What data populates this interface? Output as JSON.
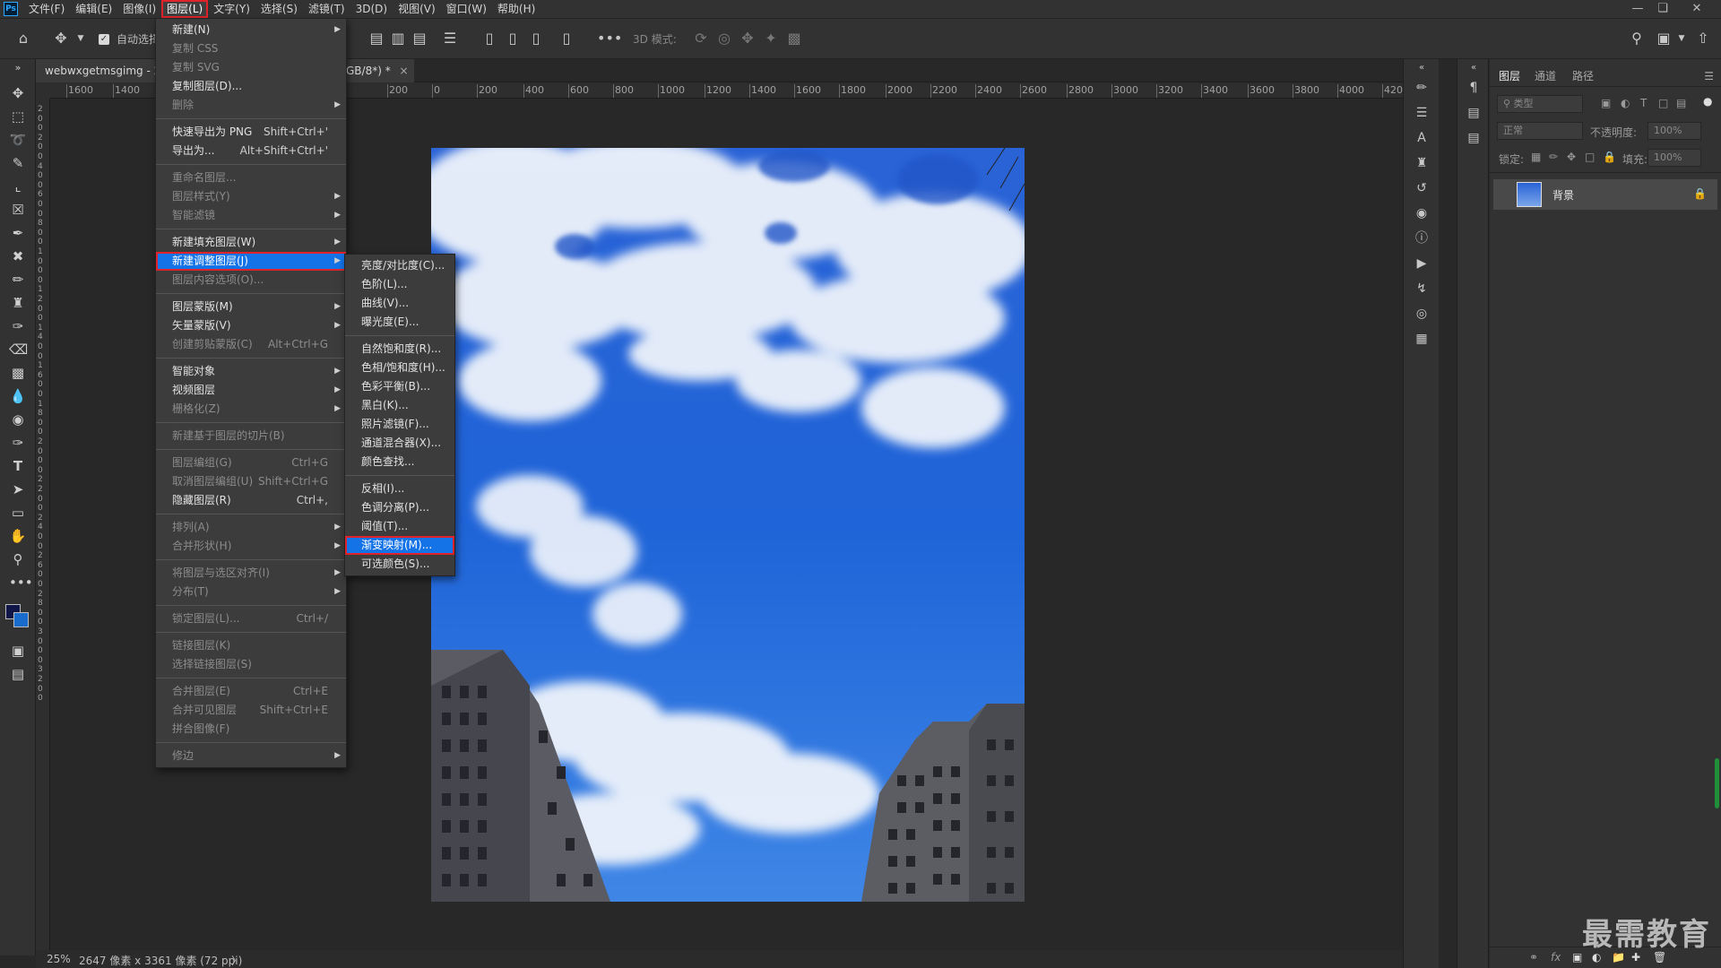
{
  "menubar": {
    "logo": "Ps",
    "items": [
      "文件(F)",
      "编辑(E)",
      "图像(I)",
      "图层(L)",
      "文字(Y)",
      "选择(S)",
      "滤镜(T)",
      "3D(D)",
      "视图(V)",
      "窗口(W)",
      "帮助(H)"
    ],
    "active_index": 3
  },
  "options": {
    "auto_select_label": "自动选择",
    "mode_3d_label": "3D 模式:"
  },
  "doc_tab": {
    "title": "webwxgetmsgimg - 2",
    "title_suffix": "GB/8*) *",
    "close": "×"
  },
  "ruler": {
    "h_ticks": [
      "1600",
      "1400",
      "200",
      "0",
      "200",
      "400",
      "600",
      "800",
      "1000",
      "1200",
      "1400",
      "1600",
      "1800",
      "2000",
      "2200",
      "2400",
      "2600",
      "2800",
      "3000",
      "3200",
      "3400",
      "3600",
      "3800",
      "4000",
      "4200"
    ],
    "v_ticks": [
      "2",
      "0",
      "0",
      "2",
      "0",
      "0",
      "4",
      "0",
      "0",
      "6",
      "0",
      "0",
      "8",
      "0",
      "0",
      "1",
      "0",
      "0",
      "0",
      "1",
      "2",
      "0",
      "0",
      "1",
      "4",
      "0",
      "0",
      "1",
      "6",
      "0",
      "0",
      "1",
      "8",
      "0",
      "0",
      "2",
      "0",
      "0",
      "0",
      "2",
      "2",
      "0",
      "0",
      "2",
      "4",
      "0",
      "0",
      "2",
      "6",
      "0",
      "0",
      "2",
      "8",
      "0",
      "0",
      "3",
      "0",
      "0",
      "0",
      "3",
      "2",
      "0",
      "0"
    ]
  },
  "status": {
    "zoom": "25%",
    "doc_info": "2647 像素 x 3361 像素 (72 ppi)",
    "arrow": "〉"
  },
  "layer_menu": {
    "items": [
      {
        "label": "新建(N)",
        "shortcut": "",
        "submenu": true,
        "disabled": false
      },
      {
        "label": "复制 CSS",
        "shortcut": "",
        "submenu": false,
        "disabled": true
      },
      {
        "label": "复制 SVG",
        "shortcut": "",
        "submenu": false,
        "disabled": true
      },
      {
        "label": "复制图层(D)...",
        "shortcut": "",
        "submenu": false,
        "disabled": false
      },
      {
        "label": "删除",
        "shortcut": "",
        "submenu": true,
        "disabled": true
      },
      {
        "sep": true
      },
      {
        "label": "快速导出为 PNG",
        "shortcut": "Shift+Ctrl+'",
        "submenu": false,
        "disabled": false
      },
      {
        "label": "导出为...",
        "shortcut": "Alt+Shift+Ctrl+'",
        "submenu": false,
        "disabled": false
      },
      {
        "sep": true
      },
      {
        "label": "重命名图层...",
        "shortcut": "",
        "submenu": false,
        "disabled": true
      },
      {
        "label": "图层样式(Y)",
        "shortcut": "",
        "submenu": true,
        "disabled": true
      },
      {
        "label": "智能滤镜",
        "shortcut": "",
        "submenu": true,
        "disabled": true
      },
      {
        "sep": true
      },
      {
        "label": "新建填充图层(W)",
        "shortcut": "",
        "submenu": true,
        "disabled": false
      },
      {
        "label": "新建调整图层(J)",
        "shortcut": "",
        "submenu": true,
        "disabled": false,
        "highlight": true
      },
      {
        "label": "图层内容选项(O)...",
        "shortcut": "",
        "submenu": false,
        "disabled": true
      },
      {
        "sep": true
      },
      {
        "label": "图层蒙版(M)",
        "shortcut": "",
        "submenu": true,
        "disabled": false
      },
      {
        "label": "矢量蒙版(V)",
        "shortcut": "",
        "submenu": true,
        "disabled": false
      },
      {
        "label": "创建剪贴蒙版(C)",
        "shortcut": "Alt+Ctrl+G",
        "submenu": false,
        "disabled": true
      },
      {
        "sep": true
      },
      {
        "label": "智能对象",
        "shortcut": "",
        "submenu": true,
        "disabled": false
      },
      {
        "label": "视频图层",
        "shortcut": "",
        "submenu": true,
        "disabled": false
      },
      {
        "label": "栅格化(Z)",
        "shortcut": "",
        "submenu": true,
        "disabled": true
      },
      {
        "sep": true
      },
      {
        "label": "新建基于图层的切片(B)",
        "shortcut": "",
        "submenu": false,
        "disabled": true
      },
      {
        "sep": true
      },
      {
        "label": "图层编组(G)",
        "shortcut": "Ctrl+G",
        "submenu": false,
        "disabled": true
      },
      {
        "label": "取消图层编组(U)",
        "shortcut": "Shift+Ctrl+G",
        "submenu": false,
        "disabled": true
      },
      {
        "label": "隐藏图层(R)",
        "shortcut": "Ctrl+,",
        "submenu": false,
        "disabled": false
      },
      {
        "sep": true
      },
      {
        "label": "排列(A)",
        "shortcut": "",
        "submenu": true,
        "disabled": true
      },
      {
        "label": "合并形状(H)",
        "shortcut": "",
        "submenu": true,
        "disabled": true
      },
      {
        "sep": true
      },
      {
        "label": "将图层与选区对齐(I)",
        "shortcut": "",
        "submenu": true,
        "disabled": true
      },
      {
        "label": "分布(T)",
        "shortcut": "",
        "submenu": true,
        "disabled": true
      },
      {
        "sep": true
      },
      {
        "label": "锁定图层(L)...",
        "shortcut": "Ctrl+/",
        "submenu": false,
        "disabled": true
      },
      {
        "sep": true
      },
      {
        "label": "链接图层(K)",
        "shortcut": "",
        "submenu": false,
        "disabled": true
      },
      {
        "label": "选择链接图层(S)",
        "shortcut": "",
        "submenu": false,
        "disabled": true
      },
      {
        "sep": true
      },
      {
        "label": "合并图层(E)",
        "shortcut": "Ctrl+E",
        "submenu": false,
        "disabled": true
      },
      {
        "label": "合并可见图层",
        "shortcut": "Shift+Ctrl+E",
        "submenu": false,
        "disabled": true
      },
      {
        "label": "拼合图像(F)",
        "shortcut": "",
        "submenu": false,
        "disabled": true
      },
      {
        "sep": true
      },
      {
        "label": "修边",
        "shortcut": "",
        "submenu": true,
        "disabled": true
      }
    ]
  },
  "adjust_submenu": {
    "items": [
      {
        "label": "亮度/对比度(C)..."
      },
      {
        "label": "色阶(L)..."
      },
      {
        "label": "曲线(V)..."
      },
      {
        "label": "曝光度(E)..."
      },
      {
        "sep": true
      },
      {
        "label": "自然饱和度(R)..."
      },
      {
        "label": "色相/饱和度(H)..."
      },
      {
        "label": "色彩平衡(B)..."
      },
      {
        "label": "黑白(K)..."
      },
      {
        "label": "照片滤镜(F)..."
      },
      {
        "label": "通道混合器(X)..."
      },
      {
        "label": "颜色查找..."
      },
      {
        "sep": true
      },
      {
        "label": "反相(I)..."
      },
      {
        "label": "色调分离(P)..."
      },
      {
        "label": "阈值(T)..."
      },
      {
        "label": "渐变映射(M)...",
        "highlight": true
      },
      {
        "label": "可选颜色(S)..."
      }
    ]
  },
  "panel": {
    "tabs": [
      "图层",
      "通道",
      "路径"
    ],
    "filter_placeholder": "类型",
    "blend_mode": "正常",
    "opacity_label": "不透明度:",
    "opacity_value": "100%",
    "lock_label": "锁定:",
    "fill_label": "填充:",
    "fill_value": "100%",
    "layer_name": "背景"
  },
  "watermark": "最需教育",
  "colors": {
    "highlight": "#1473e6",
    "outline": "#e0232b"
  }
}
